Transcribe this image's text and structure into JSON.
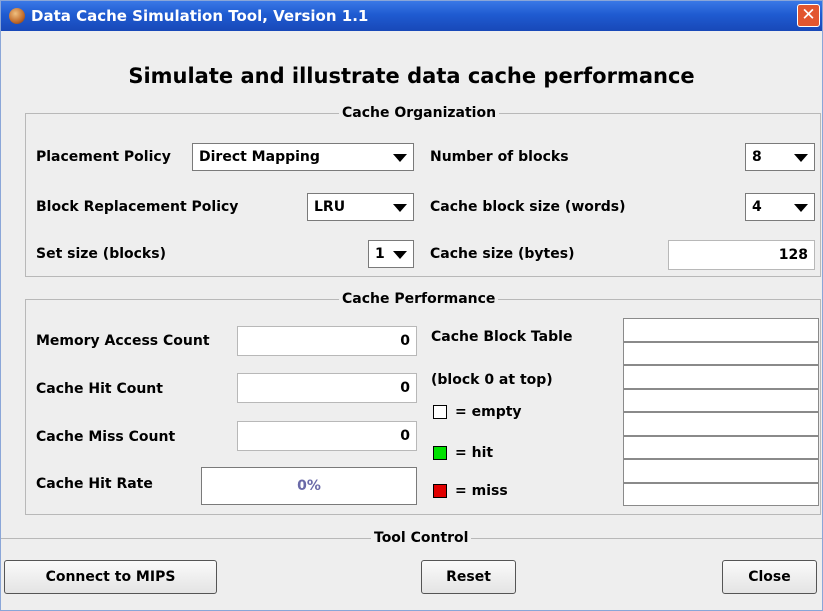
{
  "window": {
    "title": "Data Cache Simulation Tool, Version 1.1"
  },
  "heading": "Simulate and illustrate data cache performance",
  "organization": {
    "legend": "Cache Organization",
    "placement_label": "Placement Policy",
    "placement_value": "Direct Mapping",
    "replacement_label": "Block Replacement Policy",
    "replacement_value": "LRU",
    "setsize_label": "Set size (blocks)",
    "setsize_value": "1",
    "numblocks_label": "Number of blocks",
    "numblocks_value": "8",
    "blocksize_label": "Cache block size (words)",
    "blocksize_value": "4",
    "cachesize_label": "Cache size (bytes)",
    "cachesize_value": "128"
  },
  "performance": {
    "legend": "Cache Performance",
    "access_label": "Memory Access Count",
    "access_value": "0",
    "hit_label": "Cache Hit Count",
    "hit_value": "0",
    "miss_label": "Cache Miss Count",
    "miss_value": "0",
    "rate_label": "Cache Hit Rate",
    "rate_value": "0%",
    "table_label": "Cache Block Table",
    "table_sublabel": "(block 0 at top)",
    "legend_empty": "= empty",
    "legend_hit": "= hit",
    "legend_miss": "= miss",
    "colors": {
      "empty": "#ffffff",
      "hit": "#00e000",
      "miss": "#e00000"
    },
    "blocks": [
      "",
      "",
      "",
      "",
      "",
      "",
      "",
      ""
    ]
  },
  "control": {
    "legend": "Tool Control",
    "connect_label": "Connect to MIPS",
    "reset_label": "Reset",
    "close_label": "Close"
  }
}
